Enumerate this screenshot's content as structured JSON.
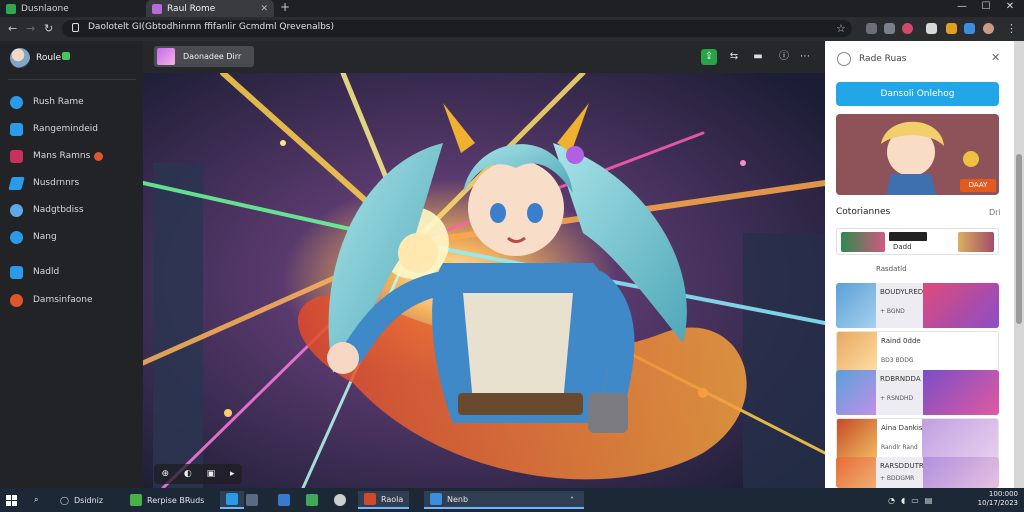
{
  "browser": {
    "tabs": [
      {
        "label": "Dusnlaone"
      },
      {
        "label": "Raul Rome"
      }
    ],
    "url": "Daolotelt GI(Gbtodhinrnn ffifanlir Gcmdml Qrevenalbs)"
  },
  "sidebar": {
    "user": "Roule",
    "items": [
      {
        "label": "Rush Rame",
        "icon": "globe-icon",
        "color": "#2a9be8"
      },
      {
        "label": "Rangemindeid",
        "icon": "edit-icon",
        "color": "#2a9be8"
      },
      {
        "label": "Mans Ramns",
        "icon": "video-icon",
        "color": "#c8325a"
      },
      {
        "label": "Nusdrnnrs",
        "icon": "pencil-icon",
        "color": "#2a9be8"
      },
      {
        "label": "Nadgtbdiss",
        "icon": "brush-icon",
        "color": "#2a9be8"
      },
      {
        "label": "Nang",
        "icon": "cloud-icon",
        "color": "#2a9be8"
      },
      {
        "label": "Nadld",
        "icon": "folder-icon",
        "color": "#2a9be8"
      },
      {
        "label": "Damsinfaone",
        "icon": "settings-icon",
        "color": "#e0562c"
      }
    ]
  },
  "viewer": {
    "title": "Daonadee Dirr",
    "controls": [
      "⊕",
      "◐",
      "▣",
      "▸"
    ]
  },
  "panel": {
    "title": "Rade Ruas",
    "cta": "Dansoli Onlehog",
    "hero_badge": "DAAY",
    "section": "Cotoriannes",
    "section_more": "Dri",
    "card_label": "Dadd",
    "card_sub": "Rasdatld",
    "rows": [
      {
        "title": "BOUDYLREDOE",
        "sub": "+ BGND"
      },
      {
        "title": "Raind 0dde",
        "sub": "BD3 BDDG"
      },
      {
        "title": "RDBRNDDA",
        "sub": "+ RSNDHD"
      },
      {
        "title": "Aina Dankis",
        "sub": "Randlr Rand"
      },
      {
        "title": "RARSDDUTRDN",
        "sub": "+ BDDGMR"
      }
    ]
  },
  "taskbar": {
    "search": "Dsidniz",
    "items": [
      {
        "label": "Rerpise BRuds"
      },
      {
        "label": "Raola"
      },
      {
        "label": "Nenb"
      }
    ],
    "time": "100:000",
    "date": "10/17/2023"
  }
}
